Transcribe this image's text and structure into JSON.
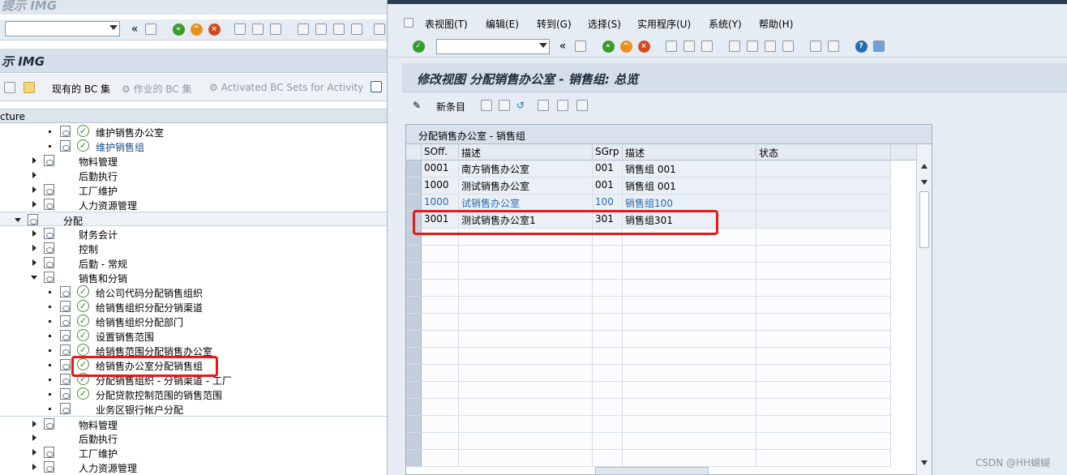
{
  "left": {
    "window_title": "提示 IMG",
    "title": "示 IMG",
    "toolbar_icons": [
      "back-icon",
      "save-icon",
      "exit-icon",
      "cancel-icon",
      "print-icon",
      "find-icon",
      "find-next-icon",
      "first-page-icon",
      "prev-page-icon",
      "next-page-icon",
      "last-page-icon"
    ],
    "app_toolbar": {
      "current_bc": "现有的 BC 集",
      "activity_bc": "作业的 BC 集",
      "activated_bc": "Activated BC Sets for Activity"
    },
    "tree_header": "cture",
    "tree": [
      {
        "label": "维护销售办公室",
        "kind": "activity",
        "link": false
      },
      {
        "label": "维护销售组",
        "kind": "activity",
        "link": true
      },
      {
        "label": "物料管理",
        "kind": "node",
        "link": false
      },
      {
        "label": "后勤执行",
        "kind": "node-nodoc",
        "link": false
      },
      {
        "label": "工厂维护",
        "kind": "node",
        "link": false
      },
      {
        "label": "人力资源管理",
        "kind": "node",
        "link": false
      },
      {
        "label": "分配",
        "kind": "open-root",
        "link": false
      },
      {
        "label": "财务会计",
        "kind": "node",
        "link": false
      },
      {
        "label": "控制",
        "kind": "node",
        "link": false
      },
      {
        "label": "后勤 - 常规",
        "kind": "node",
        "link": false
      },
      {
        "label": "销售和分销",
        "kind": "open",
        "link": false
      },
      {
        "label": "给公司代码分配销售组织",
        "kind": "activity",
        "link": false
      },
      {
        "label": "给销售组织分配分销渠道",
        "kind": "activity",
        "link": false
      },
      {
        "label": "给销售组织分配部门",
        "kind": "activity",
        "link": false
      },
      {
        "label": "设置销售范围",
        "kind": "activity",
        "link": false
      },
      {
        "label": "给销售范围分配销售办公室",
        "kind": "activity",
        "link": false
      },
      {
        "label": "给销售办公室分配销售组",
        "kind": "activity",
        "link": false
      },
      {
        "label": "分配销售组织 - 分销渠道 - 工厂",
        "kind": "activity",
        "link": false
      },
      {
        "label": "分配贷款控制范围的销售范围",
        "kind": "activity",
        "link": false
      },
      {
        "label": "业务区银行帐户分配",
        "kind": "doc-only",
        "link": false
      },
      {
        "label": "物料管理",
        "kind": "node",
        "link": false
      },
      {
        "label": "后勤执行",
        "kind": "node-nodoc",
        "link": false
      },
      {
        "label": "工厂维护",
        "kind": "node",
        "link": false
      },
      {
        "label": "人力资源管理",
        "kind": "node",
        "link": false
      }
    ]
  },
  "right": {
    "menu": [
      "表视图(T)",
      "编辑(E)",
      "转到(G)",
      "选择(S)",
      "实用程序(U)",
      "系统(Y)",
      "帮助(H)"
    ],
    "title": "修改视图 分配销售办公室 - 销售组: 总览",
    "new_entries": "新条目",
    "table": {
      "title": "分配销售办公室 - 销售组",
      "columns": [
        "SOff.",
        "描述",
        "SGrp",
        "描述",
        "状态"
      ],
      "rows": [
        {
          "soff": "0001",
          "soff_desc": "南方销售办公室",
          "sgrp": "001",
          "sgrp_desc": "销售组 001",
          "status": "",
          "blue": false
        },
        {
          "soff": "1000",
          "soff_desc": "测试销售办公室",
          "sgrp": "001",
          "sgrp_desc": "销售组 001",
          "status": "",
          "blue": false
        },
        {
          "soff": "1000",
          "soff_desc": "试销售办公室",
          "sgrp": "100",
          "sgrp_desc": "销售组100",
          "status": "",
          "blue": true
        },
        {
          "soff": "3001",
          "soff_desc": "测试销售办公室1",
          "sgrp": "301",
          "sgrp_desc": "销售组301",
          "status": "",
          "blue": false
        }
      ]
    }
  },
  "watermark": "CSDN @HH蝴蝴",
  "colors": {
    "highlight_box": "#e51a1a",
    "link_blue": "#1c4f8a",
    "title_bg": "#d5dfe9"
  }
}
